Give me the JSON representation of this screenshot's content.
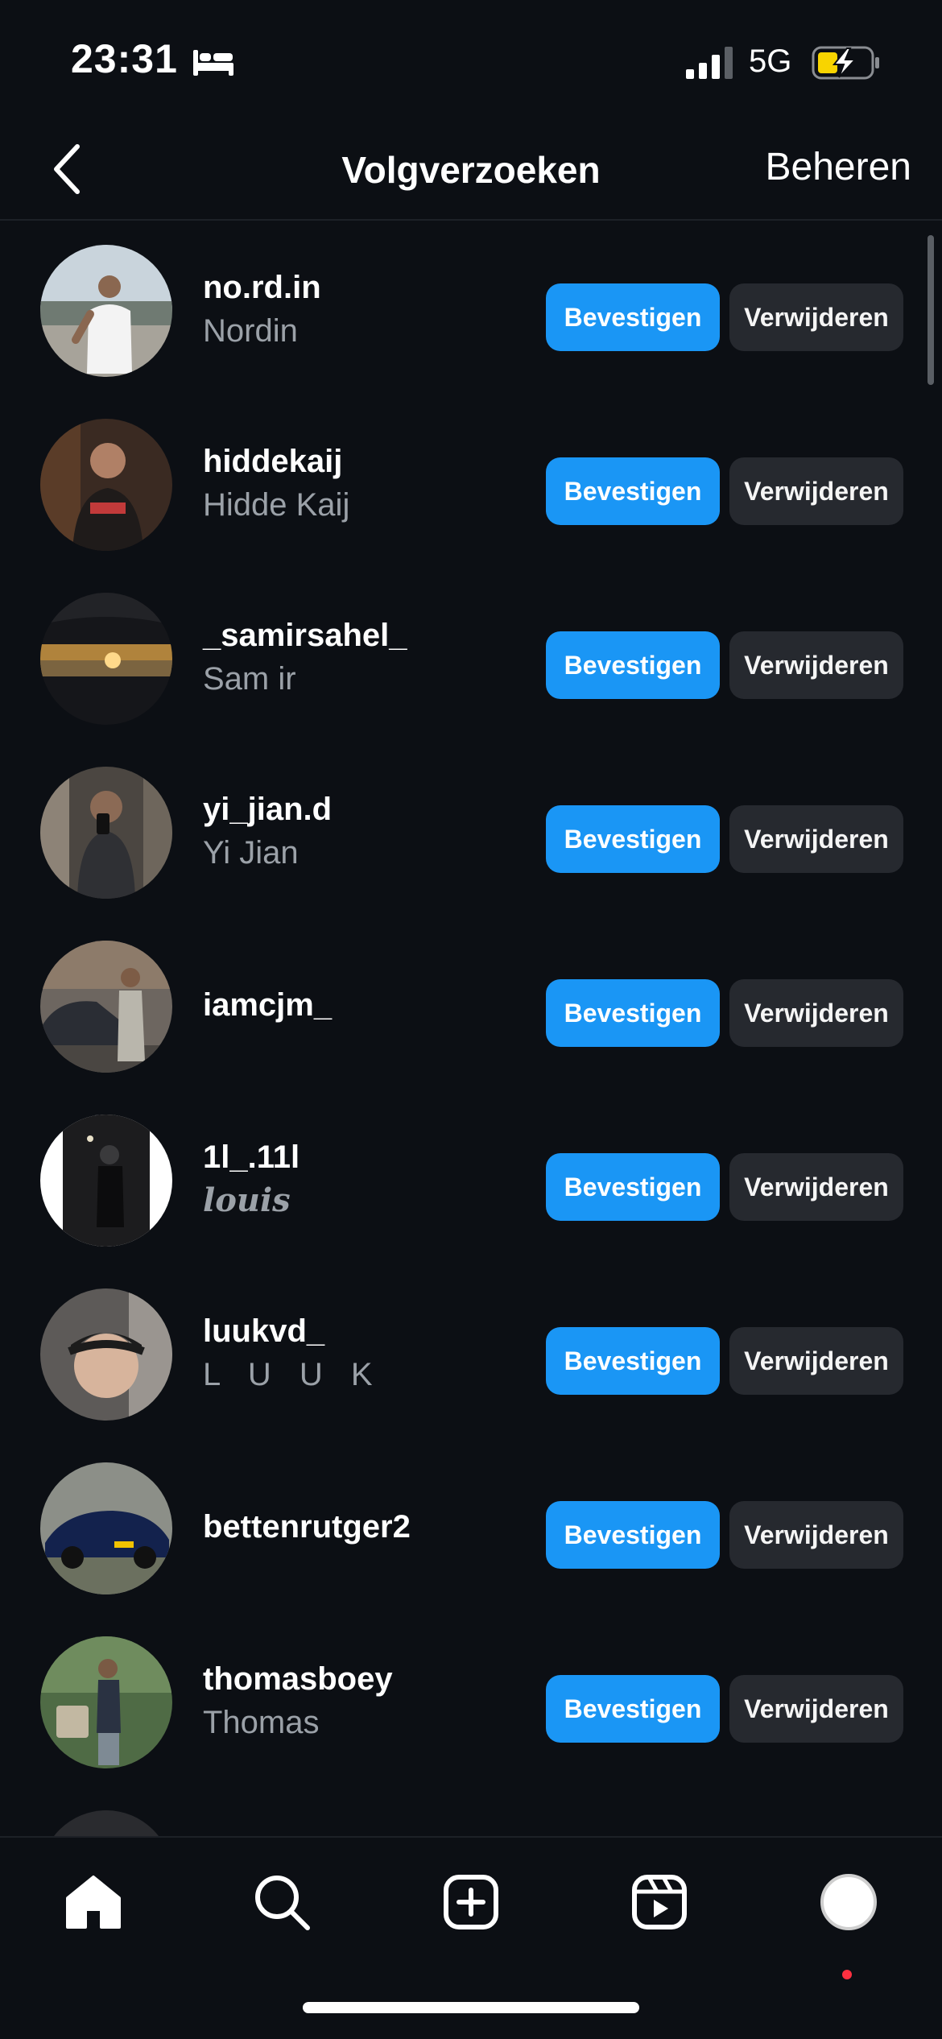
{
  "status_bar": {
    "time": "23:31",
    "network": "5G",
    "icons": [
      "sleep-bed-icon",
      "cellular-signal-icon",
      "battery-charging-icon"
    ]
  },
  "header": {
    "title": "Volgverzoeken",
    "manage_label": "Beheren",
    "back_icon": "chevron-left-icon"
  },
  "buttons": {
    "confirm_label": "Bevestigen",
    "remove_label": "Verwijderen"
  },
  "requests": [
    {
      "username": "no.rd.in",
      "fullname": "Nordin"
    },
    {
      "username": "hiddekaij",
      "fullname": "Hidde Kaij"
    },
    {
      "username": "_samirsahel_",
      "fullname": "Sam ir"
    },
    {
      "username": "yi_jian.d",
      "fullname": "Yi Jian"
    },
    {
      "username": "iamcjm_",
      "fullname": ""
    },
    {
      "username": "1l_.11l",
      "fullname": "louis"
    },
    {
      "username": "luukvd_",
      "fullname": "L U U K"
    },
    {
      "username": "bettenrutger2",
      "fullname": ""
    },
    {
      "username": "thomasboey",
      "fullname": "Thomas"
    }
  ],
  "bottom_nav": {
    "items": [
      "home-icon",
      "search-icon",
      "create-post-icon",
      "reels-icon",
      "profile-avatar"
    ],
    "accent": "#ff3040"
  },
  "colors": {
    "background": "#0c0f14",
    "confirm": "#1a96f5",
    "remove": "#26292f",
    "secondary_text": "#9ba1a8"
  }
}
